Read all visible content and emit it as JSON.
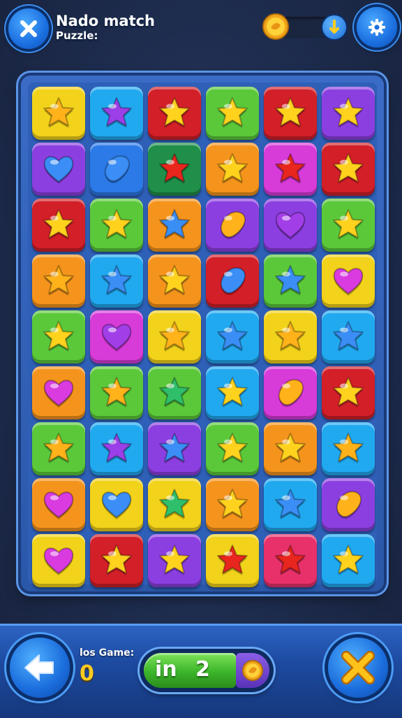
{
  "header": {
    "title_line1": "Nado match",
    "title_line2": "Puzzle:"
  },
  "footer": {
    "games_label": "los Game:",
    "games_value": "0",
    "pill_prefix": "in",
    "pill_number": "2"
  },
  "colors": {
    "yellow": "#f2d21a",
    "cyan": "#21a9f0",
    "red": "#d21f28",
    "green": "#5bc83a",
    "purple": "#8c3fe0",
    "blue": "#2b7ae8",
    "darkgreen": "#1f8f4a",
    "orange": "#f5941c",
    "magenta": "#d73bd8",
    "pink": "#e8316a"
  },
  "board": {
    "rows": 9,
    "cols": 6,
    "tiles": [
      [
        {
          "bg": "yellow",
          "shape": "star",
          "gem": "#ffb21a"
        },
        {
          "bg": "cyan",
          "shape": "star",
          "gem": "#9b3fe8"
        },
        {
          "bg": "red",
          "shape": "star",
          "gem": "#ffd21e"
        },
        {
          "bg": "green",
          "shape": "star",
          "gem": "#ffd21e"
        },
        {
          "bg": "red",
          "shape": "star",
          "gem": "#ffd21e"
        },
        {
          "bg": "purple",
          "shape": "star",
          "gem": "#ffd21e"
        }
      ],
      [
        {
          "bg": "purple",
          "shape": "heart",
          "gem": "#3a8ef5"
        },
        {
          "bg": "blue",
          "shape": "pill",
          "gem": "#3a8ef5"
        },
        {
          "bg": "darkgreen",
          "shape": "star",
          "gem": "#e8261e"
        },
        {
          "bg": "orange",
          "shape": "star",
          "gem": "#ffd21e"
        },
        {
          "bg": "magenta",
          "shape": "star",
          "gem": "#e8261e"
        },
        {
          "bg": "red",
          "shape": "star",
          "gem": "#ffd21e"
        }
      ],
      [
        {
          "bg": "red",
          "shape": "star",
          "gem": "#ffd21e"
        },
        {
          "bg": "green",
          "shape": "star",
          "gem": "#ffd21e"
        },
        {
          "bg": "orange",
          "shape": "star",
          "gem": "#3a8ef5"
        },
        {
          "bg": "purple",
          "shape": "pill",
          "gem": "#ffb21a"
        },
        {
          "bg": "purple",
          "shape": "heart",
          "gem": "#a23ee8"
        },
        {
          "bg": "green",
          "shape": "star",
          "gem": "#ffd21e"
        }
      ],
      [
        {
          "bg": "orange",
          "shape": "star",
          "gem": "#ffb21a"
        },
        {
          "bg": "cyan",
          "shape": "star",
          "gem": "#3a8ef5"
        },
        {
          "bg": "orange",
          "shape": "star",
          "gem": "#ffd21e"
        },
        {
          "bg": "red",
          "shape": "pill",
          "gem": "#3a8ef5"
        },
        {
          "bg": "green",
          "shape": "star",
          "gem": "#3a8ef5"
        },
        {
          "bg": "yellow",
          "shape": "heart",
          "gem": "#d93be0"
        }
      ],
      [
        {
          "bg": "green",
          "shape": "star",
          "gem": "#ffd21e"
        },
        {
          "bg": "magenta",
          "shape": "heart",
          "gem": "#a23ee8"
        },
        {
          "bg": "yellow",
          "shape": "star",
          "gem": "#ffb21a"
        },
        {
          "bg": "cyan",
          "shape": "star",
          "gem": "#3a8ef5"
        },
        {
          "bg": "yellow",
          "shape": "star",
          "gem": "#ffb21a"
        },
        {
          "bg": "cyan",
          "shape": "star",
          "gem": "#3a8ef5"
        }
      ],
      [
        {
          "bg": "orange",
          "shape": "heart",
          "gem": "#d93be0"
        },
        {
          "bg": "green",
          "shape": "star",
          "gem": "#ffb21a"
        },
        {
          "bg": "green",
          "shape": "star",
          "gem": "#2fbf6a"
        },
        {
          "bg": "cyan",
          "shape": "star",
          "gem": "#ffd21e"
        },
        {
          "bg": "magenta",
          "shape": "pill",
          "gem": "#ffb21a"
        },
        {
          "bg": "red",
          "shape": "star",
          "gem": "#ffd21e"
        }
      ],
      [
        {
          "bg": "green",
          "shape": "star",
          "gem": "#ffb21a"
        },
        {
          "bg": "cyan",
          "shape": "star",
          "gem": "#9b3fe8"
        },
        {
          "bg": "purple",
          "shape": "star",
          "gem": "#3a8ef5"
        },
        {
          "bg": "green",
          "shape": "star",
          "gem": "#ffd21e"
        },
        {
          "bg": "orange",
          "shape": "star",
          "gem": "#ffd21e"
        },
        {
          "bg": "cyan",
          "shape": "star",
          "gem": "#ffb21a"
        }
      ],
      [
        {
          "bg": "orange",
          "shape": "heart",
          "gem": "#d93be0"
        },
        {
          "bg": "yellow",
          "shape": "heart",
          "gem": "#3a8ef5"
        },
        {
          "bg": "yellow",
          "shape": "star",
          "gem": "#2fbf6a"
        },
        {
          "bg": "orange",
          "shape": "star",
          "gem": "#ffd21e"
        },
        {
          "bg": "cyan",
          "shape": "star",
          "gem": "#3a8ef5"
        },
        {
          "bg": "purple",
          "shape": "pill",
          "gem": "#ffb21a"
        }
      ],
      [
        {
          "bg": "yellow",
          "shape": "heart",
          "gem": "#d93be0"
        },
        {
          "bg": "red",
          "shape": "star",
          "gem": "#ffd21e"
        },
        {
          "bg": "purple",
          "shape": "star",
          "gem": "#ffd21e"
        },
        {
          "bg": "yellow",
          "shape": "star",
          "gem": "#e8261e"
        },
        {
          "bg": "pink",
          "shape": "star",
          "gem": "#e8261e"
        },
        {
          "bg": "cyan",
          "shape": "star",
          "gem": "#ffd21e"
        }
      ]
    ]
  }
}
